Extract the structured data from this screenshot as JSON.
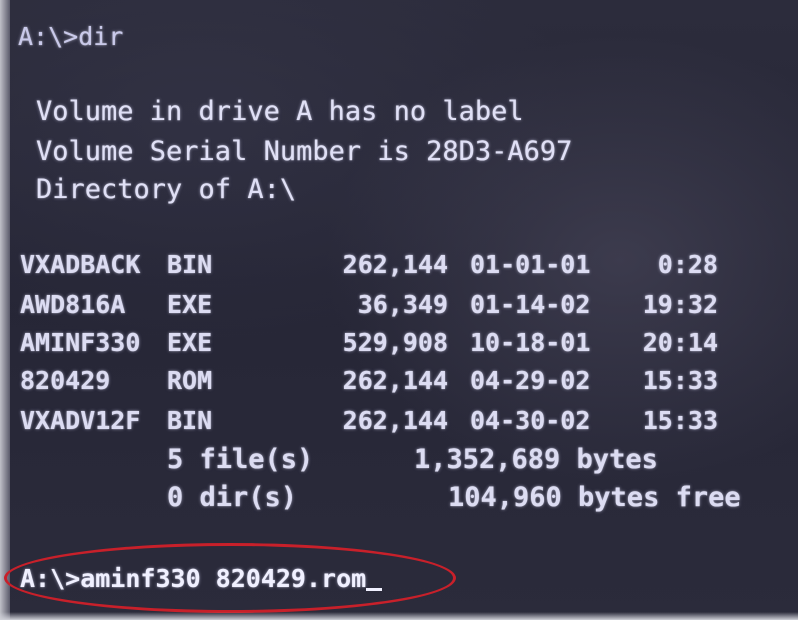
{
  "terminal": {
    "prompt_command": "A:\\>dir",
    "header": {
      "volume_label": "Volume in drive A has no label",
      "serial": "Volume Serial Number is 28D3-A697",
      "directory": "Directory of A:\\"
    },
    "files": [
      {
        "name": "VXADBACK",
        "ext": "BIN",
        "size": "262,144",
        "date": "01-01-01",
        "time": "0:28"
      },
      {
        "name": "AWD816A",
        "ext": "EXE",
        "size": "36,349",
        "date": "01-14-02",
        "time": "19:32"
      },
      {
        "name": "AMINF330",
        "ext": "EXE",
        "size": "529,908",
        "date": "10-18-01",
        "time": "20:14"
      },
      {
        "name": "820429",
        "ext": "ROM",
        "size": "262,144",
        "date": "04-29-02",
        "time": "15:33"
      },
      {
        "name": "VXADV12F",
        "ext": "BIN",
        "size": "262,144",
        "date": "04-30-02",
        "time": "15:33"
      }
    ],
    "summary": {
      "files_count": "5 file(s)",
      "files_bytes": "1,352,689 bytes",
      "dirs_count": "0 dir(s)",
      "bytes_free": "104,960 bytes free"
    },
    "current_command": "A:\\>aminf330 820429.rom"
  },
  "colors": {
    "screen_background": "#2a2a3a",
    "text": "#dcdcf2",
    "highlight": "#c8202a"
  }
}
